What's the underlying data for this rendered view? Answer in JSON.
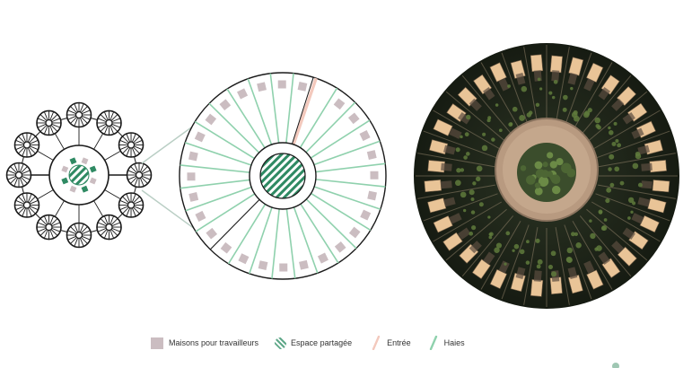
{
  "legend": {
    "houses": "Maisons pour travailleurs",
    "shared": "Espace partagée",
    "entrance": "Entrée",
    "hedges": "Haies"
  },
  "palette": {
    "house": "#cbbdc1",
    "hedge": "#8fd1ad",
    "shared": "#2f8a63",
    "entrance": "#f3c9bd",
    "outline": "#1a1a1a",
    "aerial_ground": "#1f2619",
    "aerial_plaza": "#b89a80",
    "roof": "#e9c497"
  },
  "icons": {
    "houses": "house-swatch",
    "shared": "hatched-circle-swatch",
    "entrance": "entrance-line-swatch",
    "hedges": "hedge-line-swatch"
  }
}
